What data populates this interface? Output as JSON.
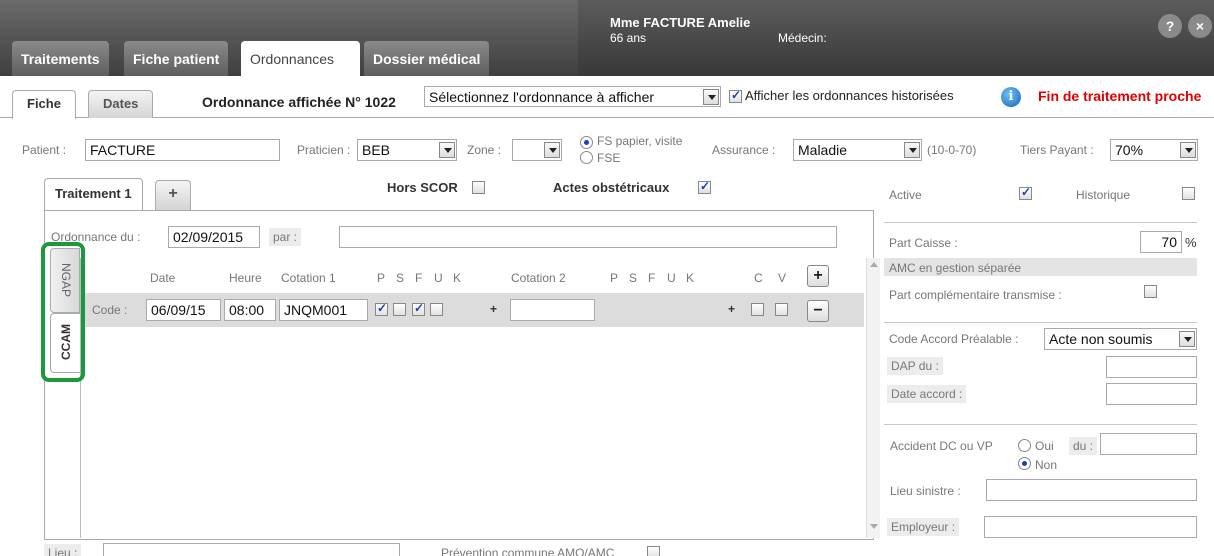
{
  "header": {
    "tabs": [
      "Traitements",
      "Fiche patient",
      "Ordonnances",
      "Dossier médical"
    ],
    "patient_name": "Mme FACTURE Amelie",
    "patient_age": "66 ans",
    "medecin_label": "Médecin:",
    "help_label": "?",
    "close_label": "×"
  },
  "subtabs": [
    "Fiche",
    "Dates"
  ],
  "ordonnance": {
    "title": "Ordonnance affichée N° 1022",
    "select_value": "Sélectionnez l'ordonnance à afficher",
    "historized_label": "Afficher les ordonnances historisées",
    "alert": "Fin de traitement proche"
  },
  "patient_row": {
    "patient_label": "Patient :",
    "patient_value": "FACTURE",
    "praticien_label": "Praticien :",
    "praticien_value": "BEB",
    "zone_label": "Zone :",
    "zone_value": "",
    "fs_papier": "FS papier, visite",
    "fse": "FSE",
    "assurance_label": "Assurance :",
    "assurance_value": "Maladie",
    "assurance_rates": "(10-0-70)",
    "tiers_label": "Tiers Payant :",
    "tiers_value": "70%"
  },
  "traitement": {
    "tab_label": "Traitement 1",
    "add_label": "+",
    "hors_scor": "Hors SCOR",
    "actes_obstetricaux": "Actes obstétricaux",
    "ordonnance_du_label": "Ordonnance du :",
    "ordonnance_du_value": "02/09/2015",
    "par_label": "par :",
    "par_value": "",
    "vertical_tabs": [
      "NGAP",
      "CCAM"
    ],
    "columns": {
      "date": "Date",
      "heure": "Heure",
      "cotation1": "Cotation 1",
      "psfuk1": [
        "P",
        "S",
        "F",
        "U",
        "K"
      ],
      "cotation2": "Cotation 2",
      "psfuk2": [
        "P",
        "S",
        "F",
        "U",
        "K"
      ],
      "c": "C",
      "v": "V"
    },
    "row": {
      "code_label": "Code :",
      "date": "06/09/15",
      "heure": "08:00",
      "cotation1": "JNQM001",
      "plus1": "+",
      "cotation2": "",
      "plus2": "+"
    },
    "add_row": "+",
    "remove_row": "−"
  },
  "right_panel": {
    "active_label": "Active",
    "historique_label": "Historique",
    "part_caisse_label": "Part Caisse :",
    "part_caisse_value": "70",
    "percent": "%",
    "amc_label": "AMC en gestion séparée",
    "part_comp_label": "Part complémentaire transmise :",
    "code_accord_label": "Code Accord Préalable :",
    "code_accord_value": "Acte non soumis",
    "dap_label": "DAP du :",
    "date_accord_label": "Date accord :",
    "accident_label": "Accident DC ou VP",
    "oui": "Oui",
    "non": "Non",
    "du_label": "du :",
    "lieu_sinistre_label": "Lieu sinistre :",
    "employeur_label": "Employeur :"
  },
  "bottom": {
    "lieu_label": "Lieu :",
    "prevention_label": "Prévention commune AMO/AMC"
  },
  "colors": {
    "highlight": "#1a9a3a",
    "alert": "#e00000",
    "header_dark": "#4a4a4a"
  }
}
